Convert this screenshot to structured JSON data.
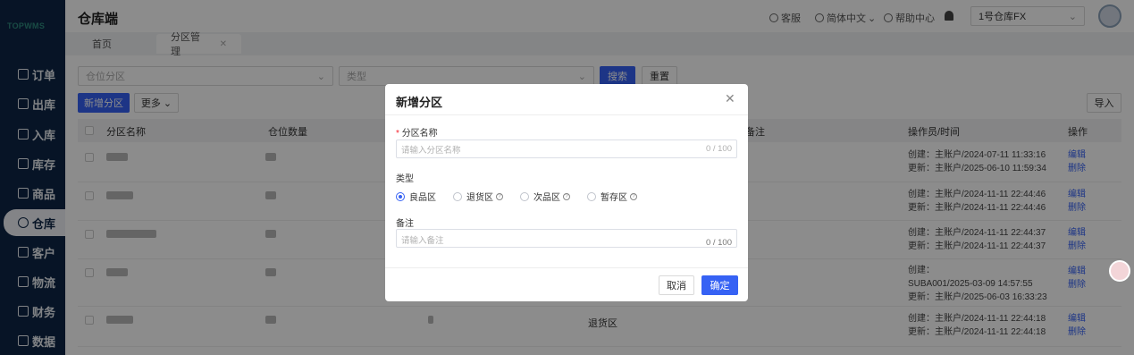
{
  "app": {
    "title": "仓库端",
    "logo": "TOPWMS"
  },
  "sidebar": {
    "items": [
      {
        "label": "订单",
        "icon": "order-icon"
      },
      {
        "label": "出库",
        "icon": "outbound-icon"
      },
      {
        "label": "入库",
        "icon": "inbound-icon"
      },
      {
        "label": "库存",
        "icon": "inventory-icon"
      },
      {
        "label": "商品",
        "icon": "product-icon"
      },
      {
        "label": "仓库",
        "icon": "warehouse-icon",
        "active": true
      },
      {
        "label": "客户",
        "icon": "customer-icon"
      },
      {
        "label": "物流",
        "icon": "logistics-icon"
      },
      {
        "label": "财务",
        "icon": "finance-icon"
      },
      {
        "label": "数据",
        "icon": "data-icon"
      }
    ]
  },
  "header": {
    "service": "客服",
    "language": "简体中文",
    "help": "帮助中心",
    "warehouse_select": "1号仓库FX"
  },
  "tabs": [
    {
      "label": "首页"
    },
    {
      "label": "分区管理",
      "active": true
    }
  ],
  "filters": {
    "zone_placeholder": "仓位分区",
    "type_placeholder": "类型",
    "search": "搜索",
    "reset": "重置"
  },
  "toolbar": {
    "add": "新增分区",
    "more": "更多",
    "import": "导入"
  },
  "table": {
    "headers": {
      "name": "分区名称",
      "count": "仓位数量",
      "remark": "备注",
      "operator": "操作员/时间",
      "action": "操作"
    },
    "rows": [
      {
        "op1": "创建：主账户/2024-07-11 11:33:16",
        "op2": "更新：主账户/2025-06-10 11:59:34"
      },
      {
        "op1": "创建：主账户/2024-11-11 22:44:46",
        "op2": "更新：主账户/2024-11-11 22:44:46"
      },
      {
        "op1": "创建：主账户/2024-11-11 22:44:37",
        "op2": "更新：主账户/2024-11-11 22:44:37"
      },
      {
        "op1": "创建：",
        "op2": "SUBA001/2025-03-09 14:57:55",
        "op3": "更新：主账户/2025-06-03 16:33:23"
      },
      {
        "type": "退货区",
        "op1": "创建：主账户/2024-11-11 22:44:18",
        "op2": "更新：主账户/2024-11-11 22:44:18"
      }
    ],
    "edit": "编辑",
    "delete": "删除"
  },
  "modal": {
    "title": "新增分区",
    "name_label": "分区名称",
    "name_required_mark": "*",
    "name_placeholder": "请输入分区名称",
    "name_count": "0 / 100",
    "type_label": "类型",
    "types": [
      "良品区",
      "退货区",
      "次品区",
      "暂存区"
    ],
    "selected_type": "良品区",
    "remark_label": "备注",
    "remark_placeholder": "请输入备注",
    "remark_count": "0 / 100",
    "cancel": "取消",
    "confirm": "确定"
  },
  "colors": {
    "sidebar": "#0d2645",
    "primary": "#3662f4"
  }
}
